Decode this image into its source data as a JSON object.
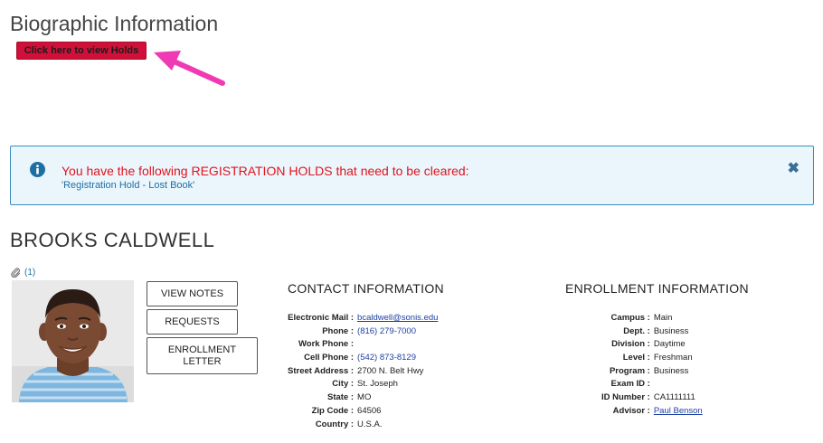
{
  "header": {
    "title": "Biographic Information",
    "holds_button": "Click here to view Holds"
  },
  "alert": {
    "message": "You have the following REGISTRATION HOLDS that need to be cleared:",
    "hold_item": "'Registration Hold - Lost Book'",
    "close_glyph": "✖"
  },
  "student": {
    "name": "BROOKS CALDWELL",
    "attachment_count": "(1)"
  },
  "buttons": {
    "view_notes": "VIEW NOTES",
    "requests": "REQUESTS",
    "enrollment_letter": "ENROLLMENT LETTER"
  },
  "contact": {
    "title": "CONTACT INFORMATION",
    "rows": [
      {
        "label": "Electronic Mail :",
        "value": "bcaldwell@sonis.edu"
      },
      {
        "label": "Phone :",
        "value": "(816) 279-7000"
      },
      {
        "label": "Work Phone :",
        "value": ""
      },
      {
        "label": "Cell Phone :",
        "value": "(542) 873-8129"
      },
      {
        "label": "Street Address :",
        "value": "2700 N. Belt Hwy"
      },
      {
        "label": "City :",
        "value": "St. Joseph"
      },
      {
        "label": "State :",
        "value": "MO"
      },
      {
        "label": "Zip Code :",
        "value": "64506"
      },
      {
        "label": "Country :",
        "value": "U.S.A."
      }
    ]
  },
  "enrollment": {
    "title": "ENROLLMENT INFORMATION",
    "rows": [
      {
        "label": "Campus :",
        "value": "Main"
      },
      {
        "label": "Dept. :",
        "value": "Business"
      },
      {
        "label": "Division :",
        "value": "Daytime"
      },
      {
        "label": "Level :",
        "value": "Freshman"
      },
      {
        "label": "Program :",
        "value": "Business"
      },
      {
        "label": "Exam ID :",
        "value": ""
      },
      {
        "label": "ID Number :",
        "value": "CA1111111"
      },
      {
        "label": "Advisor :",
        "value": "Paul Benson"
      }
    ]
  },
  "colors": {
    "holds_button": "#d1103a",
    "alert_bg": "#eaf6fc",
    "alert_border": "#3b8dbd",
    "alert_text": "#e0141e",
    "annotation_arrow": "#f03ab4"
  }
}
